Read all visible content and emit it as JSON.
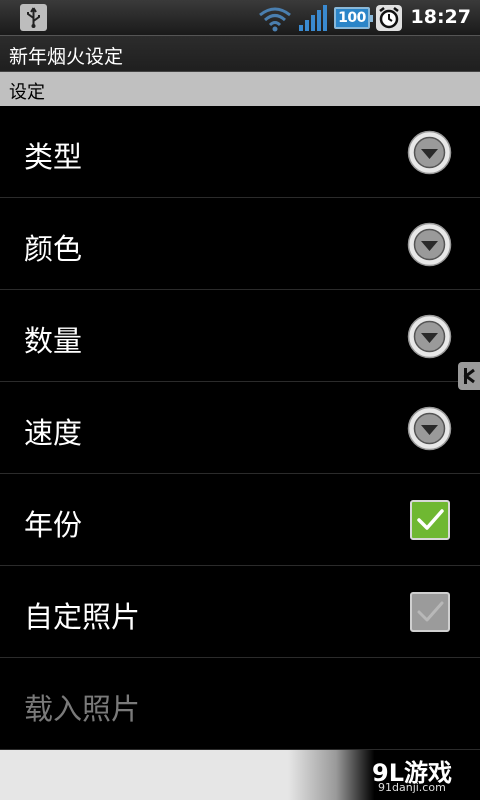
{
  "status_bar": {
    "battery_level": "100",
    "time": "18:27",
    "icons": [
      "usb-icon",
      "wifi-icon",
      "signal-icon",
      "battery-icon",
      "alarm-icon"
    ]
  },
  "title_bar": {
    "title": "新年烟火设定"
  },
  "section": {
    "label": "设定"
  },
  "prefs": [
    {
      "label": "类型",
      "control": "dropdown"
    },
    {
      "label": "颜色",
      "control": "dropdown"
    },
    {
      "label": "数量",
      "control": "dropdown"
    },
    {
      "label": "速度",
      "control": "dropdown"
    },
    {
      "label": "年份",
      "control": "checkbox",
      "checked": true
    },
    {
      "label": "自定照片",
      "control": "checkbox",
      "checked": false
    },
    {
      "label": "载入照片",
      "control": "none",
      "enabled": false
    }
  ],
  "watermark": {
    "main": "9L游戏",
    "sub": "91danji.com"
  },
  "colors": {
    "background": "#000000",
    "section_header": "#c0c0c0",
    "checkbox_on": "#6fb832",
    "battery": "#2b85c8"
  }
}
